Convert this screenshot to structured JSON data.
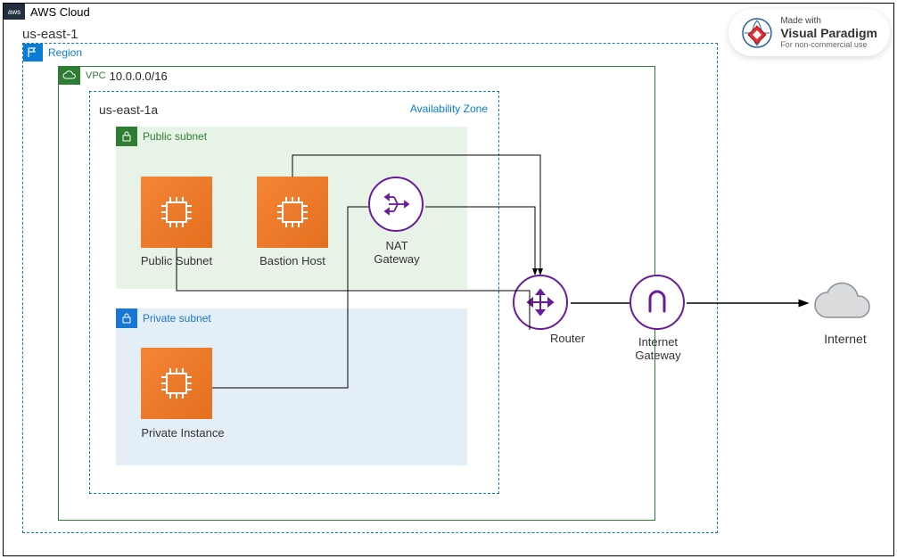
{
  "diagram": {
    "cloud_label": "AWS Cloud",
    "region_title": "Region",
    "region_name": "us-east-1",
    "vpc_label": "VPC",
    "vpc_cidr": "10.0.0.0/16",
    "az_name": "us-east-1a",
    "az_label": "Availability Zone",
    "public_subnet_label": "Public subnet",
    "private_subnet_label": "Private subnet",
    "nodes": {
      "public_subnet_ec2": "Public Subnet",
      "bastion": "Bastion Host",
      "nat": "NAT Gateway",
      "private_instance": "Private Instance",
      "router": "Router",
      "igw": "Internet Gateway",
      "internet": "Internet"
    }
  },
  "watermark": {
    "made": "Made with",
    "brand": "Visual Paradigm",
    "sub": "For non-commercial use"
  },
  "colors": {
    "region_blue": "#0a7dd6",
    "vpc_green": "#2e7d32",
    "ec2_orange": "#f58536",
    "purple": "#6a1b9a"
  }
}
